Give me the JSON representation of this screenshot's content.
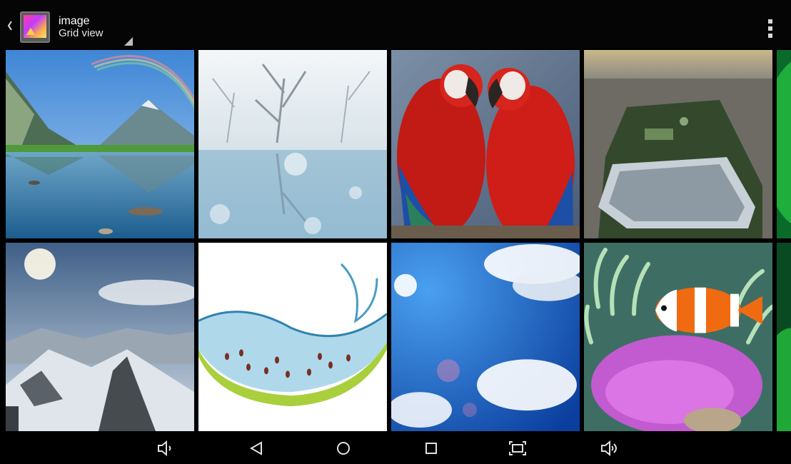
{
  "actionbar": {
    "title": "image",
    "subtitle": "Grid view",
    "icons": {
      "up": "chevron-left-icon",
      "app": "gallery-app-icon",
      "spinner": "spinner-triangle-icon",
      "overflow": "overflow-menu-icon"
    }
  },
  "grid": {
    "rows": 2,
    "visible_columns": 4,
    "items": [
      "mountain-lake-rainbow-photo",
      "snowy-lake-photo",
      "macaws-photo",
      "aerial-park-photo",
      "partial-green-photo",
      "snowy-mountains-photo",
      "watermelon-splash-photo",
      "blue-sky-clouds-photo",
      "clownfish-anemone-photo",
      "partial-green-photo-2"
    ]
  },
  "navbar": {
    "buttons": [
      "volume-down-icon",
      "back-icon",
      "home-icon",
      "recents-icon",
      "screenshot-icon",
      "volume-up-icon"
    ]
  }
}
